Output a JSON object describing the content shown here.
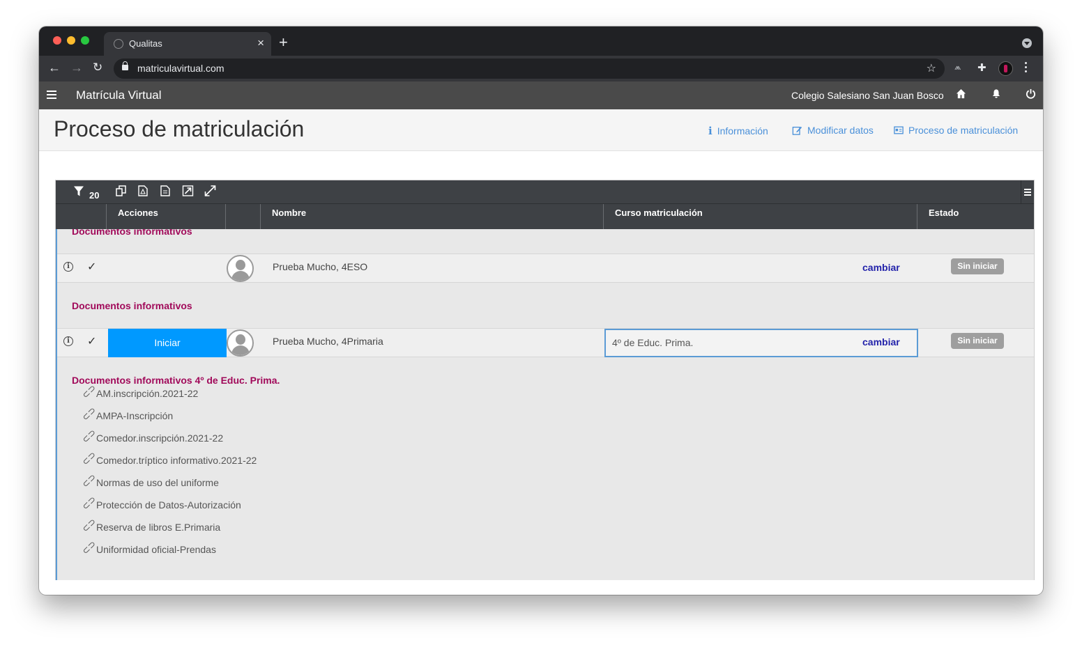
{
  "browser": {
    "tab_title": "Qualitas",
    "url": "matriculavirtual.com",
    "colors": {
      "red": "#ff5f57",
      "yellow": "#febc2e",
      "green": "#28c840"
    }
  },
  "app": {
    "title": "Matrícula Virtual",
    "school": "Colegio Salesiano San Juan Bosco"
  },
  "page": {
    "title": "Proceso de matriculación",
    "links": [
      {
        "label": "Información",
        "icon": "info-icon"
      },
      {
        "label": "Modificar datos",
        "icon": "edit-icon"
      },
      {
        "label": "Proceso de matriculación",
        "icon": "id-card-icon"
      }
    ]
  },
  "grid": {
    "filter_count": "20",
    "columns": [
      "Acciones",
      "Nombre",
      "Curso matriculación",
      "Estado"
    ],
    "top_section_label": "Documentos informativos",
    "rows": [
      {
        "name": "Prueba Mucho, 4ESO",
        "curso": "",
        "cambiar": "cambiar",
        "estado": "Sin iniciar",
        "section_label": "Documentos informativos"
      },
      {
        "name": "Prueba Mucho, 4Primaria",
        "action": "Iniciar",
        "curso": "4º de Educ. Prima.",
        "cambiar": "cambiar",
        "estado": "Sin iniciar",
        "section_label": "Documentos informativos 4º de Educ. Prima."
      }
    ],
    "documents": [
      "AM.inscripción.2021-22",
      "AMPA-Inscripción",
      "Comedor.inscripción.2021-22",
      "Comedor.tríptico informativo.2021-22",
      "Normas de uso del uniforme",
      "Protección de Datos-Autorización",
      "Reserva de libros E.Primaria",
      "Uniformidad oficial-Prendas"
    ]
  }
}
